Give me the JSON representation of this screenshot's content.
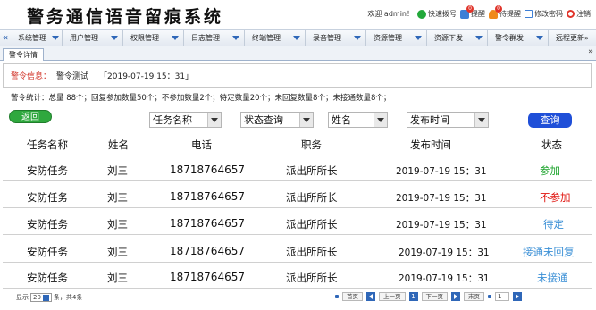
{
  "app": {
    "title": "警务通信语音留痕系统"
  },
  "header": {
    "welcome": "欢迎 admin！",
    "quick_dial": "快速拨号",
    "remind": "提醒",
    "remind_count": "0",
    "todo": "待提醒",
    "todo_count": "0",
    "change_pwd": "修改密码",
    "logout": "注销"
  },
  "nav": {
    "left_arrow": "«",
    "items": [
      {
        "label": "系统管理"
      },
      {
        "label": "用户管理"
      },
      {
        "label": "权限管理"
      },
      {
        "label": "日志管理"
      },
      {
        "label": "终端管理"
      },
      {
        "label": "录音管理"
      },
      {
        "label": "资源管理"
      },
      {
        "label": "资源下发"
      },
      {
        "label": "警令群发"
      }
    ],
    "more": "远程更新»"
  },
  "tabs": {
    "active": "警令详情",
    "collapse": "»"
  },
  "info": {
    "label": "警令信息：",
    "title": "警令测试",
    "time": "「2019-07-19 15：31」"
  },
  "stats": {
    "text": "警令统计：总量 88个；回复参加数量50个；不参加数量2个；待定数量20个；未回复数量8个；未接通数量8个；"
  },
  "filters": {
    "back": "返回",
    "task_name": "任务名称",
    "status": "状态查询",
    "name": "姓名",
    "publish_time": "发布时间",
    "query": "查询"
  },
  "table": {
    "headers": [
      "任务名称",
      "姓名",
      "电话",
      "职务",
      "发布时间",
      "状态"
    ],
    "rows": [
      {
        "task": "安防任务",
        "name": "刘三",
        "phone": "18718764657",
        "role": "派出所所长",
        "time": "2019-07-19 15：31",
        "status": "参加"
      },
      {
        "task": "安防任务",
        "name": "刘三",
        "phone": "18718764657",
        "role": "派出所所长",
        "time": "2019-07-19 15：31",
        "status": "不参加"
      },
      {
        "task": "安防任务",
        "name": "刘三",
        "phone": "18718764657",
        "role": "派出所所长",
        "time": "2019-07-19 15：31",
        "status": "待定"
      },
      {
        "task": "安防任务",
        "name": "刘三",
        "phone": "18718764657",
        "role": "派出所所长",
        "time": "2019-07-19 15：31",
        "status": "接通未回复"
      },
      {
        "task": "安防任务",
        "name": "刘三",
        "phone": "18718764657",
        "role": "派出所所长",
        "time": "2019-07-19 15：31",
        "status": "未接通"
      }
    ]
  },
  "status_colors": {
    "参加": "#1fa52f",
    "不参加": "#e0140e",
    "待定": "#3a8fd6",
    "接通未回复": "#3a8fd6",
    "未接通": "#3a8fd6"
  },
  "pager": {
    "show": "显示",
    "page_size": "20",
    "suffix": "条，共4条",
    "first": "首页",
    "prev": "上一页",
    "current": "1",
    "next": "下一页",
    "last": "末页",
    "jump_value": "1"
  }
}
